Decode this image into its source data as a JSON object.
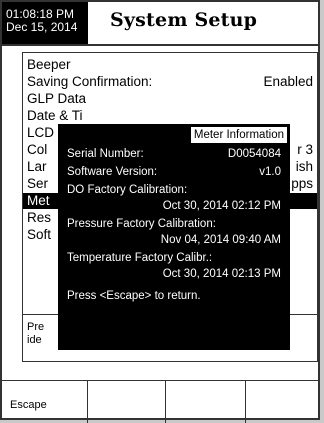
{
  "header": {
    "time": "01:08:18 PM",
    "date": "Dec 15, 2014",
    "title": "System Setup"
  },
  "menu": {
    "items": [
      {
        "label": "Beeper",
        "value": ""
      },
      {
        "label": "Saving Confirmation:",
        "value": "Enabled"
      },
      {
        "label": "GLP Data",
        "value": ""
      },
      {
        "label": "Date & Ti",
        "value": ""
      },
      {
        "label": "LCD",
        "value": ""
      },
      {
        "label": "Col",
        "value": "r 3"
      },
      {
        "label": "Lar",
        "value": "ish"
      },
      {
        "label": "Ser",
        "value": "pps"
      },
      {
        "label": "Met",
        "value": ""
      },
      {
        "label": "Res",
        "value": ""
      },
      {
        "label": "Soft",
        "value": ""
      }
    ],
    "selected_index": 8
  },
  "prompt": {
    "line1": "Pre",
    "line2": "ide"
  },
  "softkeys": [
    "Escape",
    "",
    "",
    ""
  ],
  "popup": {
    "title": "Meter Information",
    "serial_label": "Serial Number:",
    "serial_value": "D0054084",
    "software_label": "Software Version:",
    "software_value": "v1.0",
    "do_label": "DO Factory Calibration:",
    "do_value": "Oct 30, 2014 02:12 PM",
    "pressure_label": "Pressure Factory Calibration:",
    "pressure_value": "Nov 04, 2014 09:40 AM",
    "temp_label": "Temperature Factory Calibr.:",
    "temp_value": "Oct 30, 2014 02:13 PM",
    "escape_hint": "Press <Escape> to return."
  }
}
